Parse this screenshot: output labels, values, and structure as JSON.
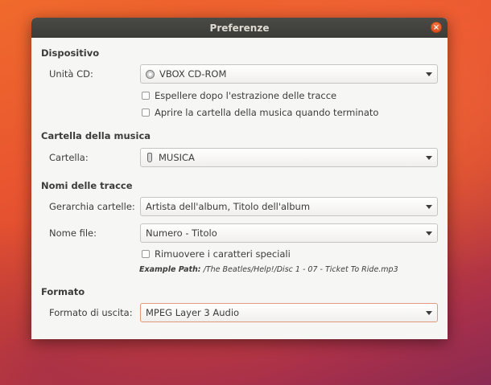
{
  "window": {
    "title": "Preferenze",
    "close_glyph": "×"
  },
  "device": {
    "section_title": "Dispositivo",
    "cd_label": "Unità CD:",
    "cd_value": "VBOX CD-ROM",
    "cd_icon": "cd-icon",
    "eject_label": "Espellere dopo l'estrazione delle tracce",
    "open_folder_label": "Aprire la cartella della musica quando terminato"
  },
  "music_folder": {
    "section_title": "Cartella della musica",
    "folder_label": "Cartella:",
    "folder_value": "MUSICA",
    "folder_icon": "folder-icon"
  },
  "track_names": {
    "section_title": "Nomi delle tracce",
    "hierarchy_label": "Gerarchia cartelle:",
    "hierarchy_value": "Artista dell'album, Titolo dell'album",
    "filename_label": "Nome file:",
    "filename_value": "Numero - Titolo",
    "strip_label": "Rimuovere i caratteri speciali",
    "example_prefix": "Example Path:",
    "example_path": "/The Beatles/Help!/Disc 1 - 07 - Ticket To Ride.mp3"
  },
  "format": {
    "section_title": "Formato",
    "output_label": "Formato di uscita:",
    "output_value": "MPEG Layer 3 Audio"
  },
  "colors": {
    "accent": "#e95420",
    "focus_border": "#e09a7a"
  }
}
